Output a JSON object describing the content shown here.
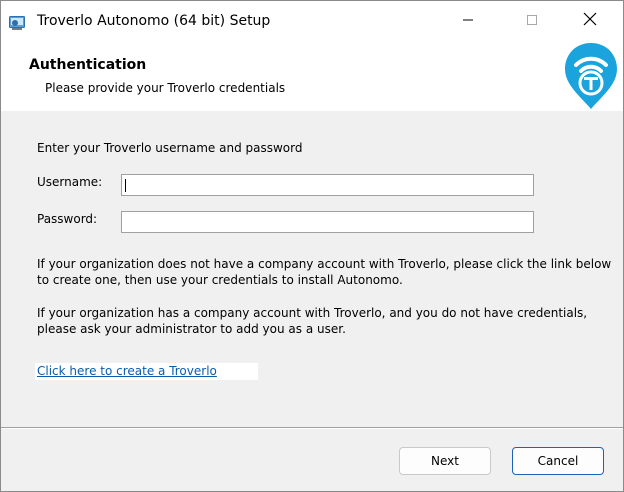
{
  "window": {
    "title": "Troverlo Autonomo (64 bit) Setup",
    "controls": {
      "minimize": "minimize-icon",
      "maximize": "maximize-icon",
      "close": "close-icon"
    }
  },
  "header": {
    "title": "Authentication",
    "subtitle": "Please provide your Troverlo credentials",
    "logo": "troverlo-logo-icon",
    "logo_color": "#1ba3dd"
  },
  "form": {
    "intro": "Enter your Troverlo username and password",
    "username_label": "Username:",
    "username_value": "",
    "password_label": "Password:",
    "password_value": ""
  },
  "info": {
    "paragraph1_line1": "If your organization does not have a company account with Troverlo, please click the link below",
    "paragraph1_line2": "to create one, then use your credentials to install Autonomo.",
    "paragraph2_line1": "If your organization has a company account with Troverlo, and you do not have credentials,",
    "paragraph2_line2": "please ask your administrator to add you as a user."
  },
  "link": {
    "text": "Click here to create a Troverlo",
    "color": "#0b5cad"
  },
  "buttons": {
    "next": "Next",
    "cancel": "Cancel",
    "cancel_border_color": "#1c62b9"
  }
}
